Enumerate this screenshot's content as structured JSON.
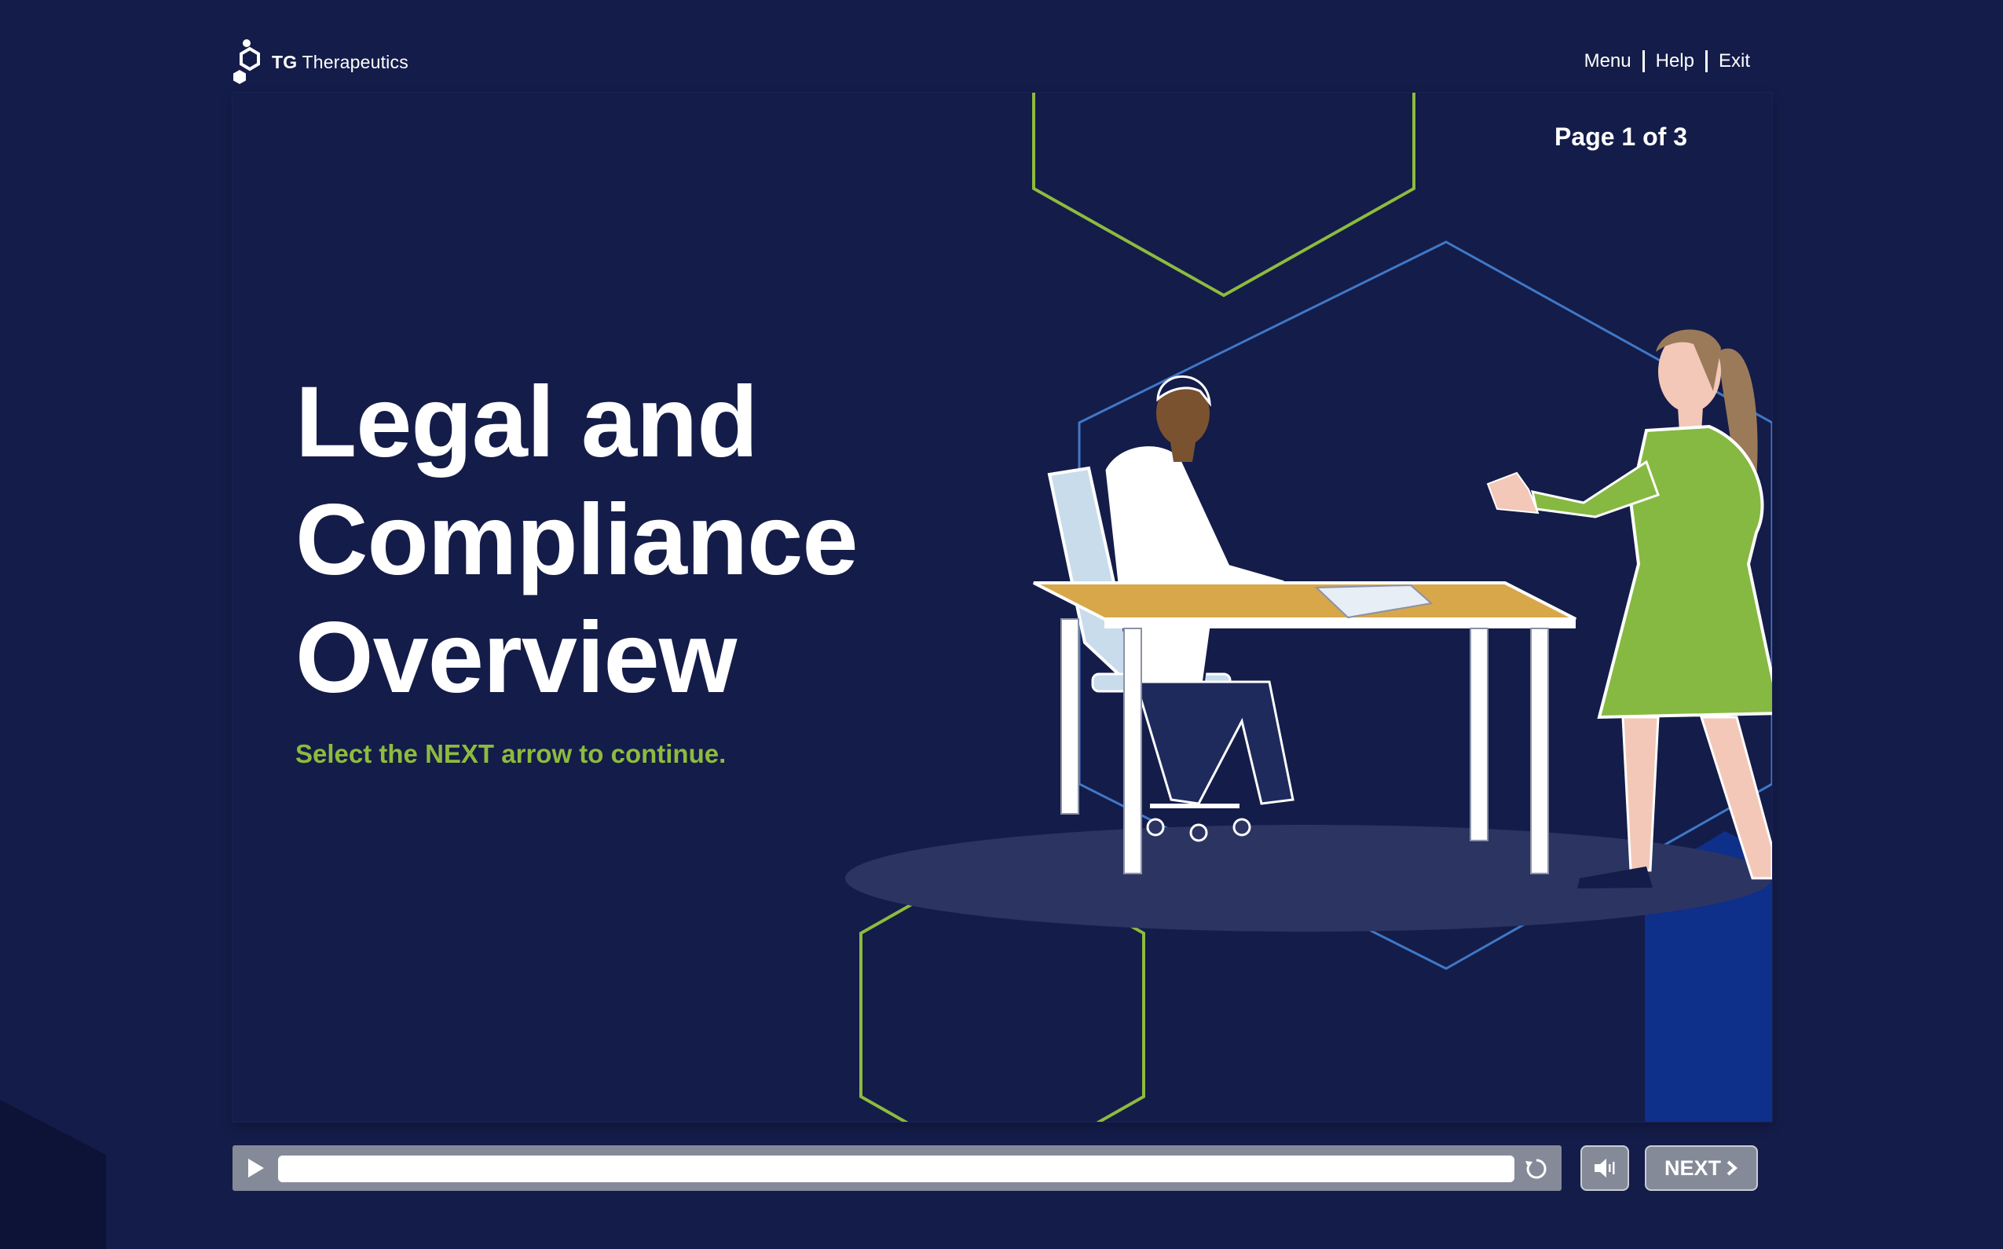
{
  "brand": {
    "strong": "TG",
    "rest": "Therapeutics"
  },
  "nav": {
    "menu": "Menu",
    "help": "Help",
    "exit": "Exit"
  },
  "slide": {
    "page_indicator": "Page 1 of 3",
    "title_lines": [
      "Legal and",
      "Compliance",
      "Overview"
    ],
    "instruction": "Select the NEXT arrow to continue."
  },
  "player": {
    "next_label": "NEXT",
    "progress_fraction": 1.0
  },
  "colors": {
    "background": "#141c49",
    "accent_green": "#8dbb3e",
    "hex_blue": "#3f78c8",
    "desk": "#d7a74a",
    "dress": "#86b941",
    "controls": "#858a98"
  },
  "icons": {
    "play": "play-icon",
    "replay": "replay-icon",
    "volume": "volume-icon",
    "next": "chevron-right-icon",
    "logo": "hexagon-logo-icon"
  }
}
